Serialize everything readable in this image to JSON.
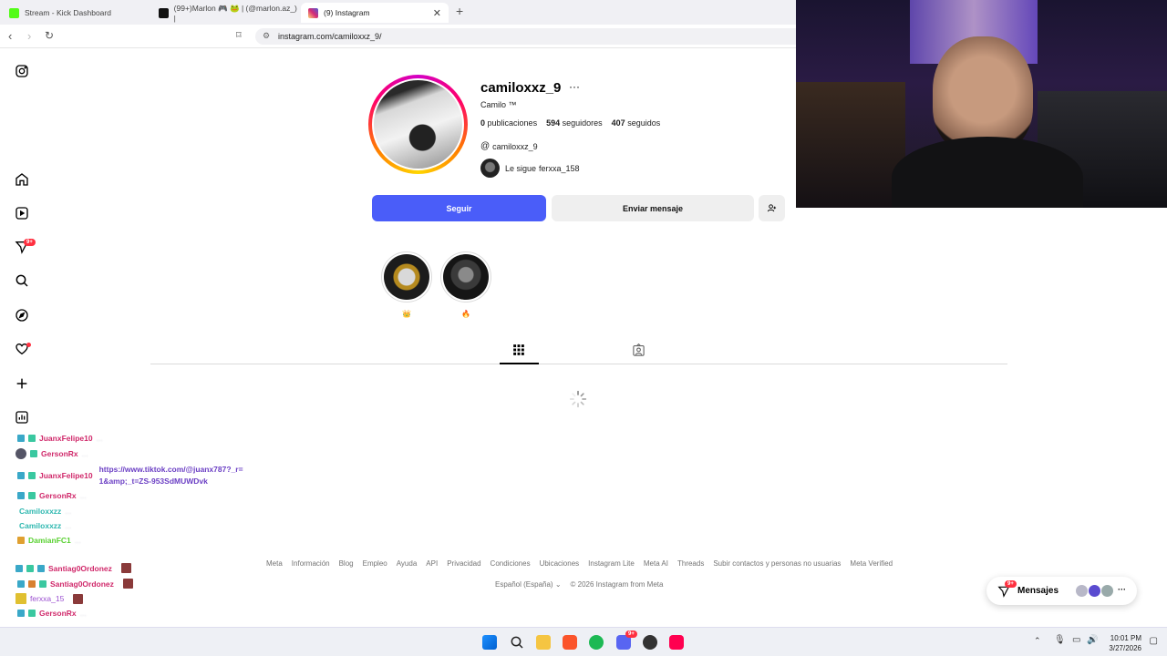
{
  "browser": {
    "tabs": [
      {
        "title": "Stream - Kick Dashboard",
        "color": "#53fc18"
      },
      {
        "title": "(99+)Marlon 🎮 🐸 | (@marlon.az_) |",
        "color": "#000000"
      },
      {
        "title": "(9) Instagram",
        "color": "#e1306c"
      }
    ],
    "url": "instagram.com/camiloxxz_9/"
  },
  "nav": {
    "notifications_badge": "9+"
  },
  "profile": {
    "username": "camiloxxz_9",
    "more_label": "···",
    "full_name": "Camilo ™",
    "stats": {
      "posts_count": "0",
      "posts_label": "publicaciones",
      "followers_count": "594",
      "followers_label": "seguidores",
      "following_count": "407",
      "following_label": "seguidos"
    },
    "threads_handle": "camiloxxz_9",
    "followed_by_prefix": "Le sigue",
    "followed_by_user": "ferxxa_158",
    "follow_label": "Seguir",
    "message_label": "Enviar mensaje"
  },
  "highlights": [
    {
      "label": "👑"
    },
    {
      "label": "🔥"
    }
  ],
  "footer": {
    "links": [
      "Meta",
      "Información",
      "Blog",
      "Empleo",
      "Ayuda",
      "API",
      "Privacidad",
      "Condiciones",
      "Ubicaciones",
      "Instagram Lite",
      "Meta AI",
      "Threads",
      "Subir contactos y personas no usuarias",
      "Meta Verified"
    ],
    "language": "Español (España)",
    "copyright": "© 2026 Instagram from Meta"
  },
  "messages": {
    "label": "Mensajes",
    "badge": "9+"
  },
  "chat": [
    {
      "user": "JuanxFelipe10",
      "color": "#d0286a",
      "message": "..."
    },
    {
      "user": "GersonRx",
      "color": "#d0286a",
      "message": "..."
    },
    {
      "user": "JuanxFelipe10",
      "color": "#d0286a",
      "message": "https://www.tiktok.com/@juanx787?_r=1&amp;_t=ZS-953SdMUWDvk"
    },
    {
      "user": "GersonRx",
      "color": "#d0286a",
      "message": "..."
    },
    {
      "user": "Camiloxxzz",
      "color": "#2fb8b0",
      "message": "..."
    },
    {
      "user": "Camiloxxzz",
      "color": "#2fb8b0",
      "message": "..."
    },
    {
      "user": "DamianFC1",
      "color": "#58d030",
      "message": "..."
    },
    {
      "user": "Santiag0Ordonez",
      "color": "#d0286a",
      "message": ""
    },
    {
      "user": "Santiag0Ordonez",
      "color": "#d0286a",
      "message": ""
    },
    {
      "user": "ferxxa_15",
      "color": "#9b4fd0",
      "message": ""
    },
    {
      "user": "GersonRx",
      "color": "#d0286a",
      "message": "..."
    }
  ],
  "taskbar": {
    "time": "10:01 PM",
    "date": "3/27/2026",
    "discord_badge": "9+"
  }
}
